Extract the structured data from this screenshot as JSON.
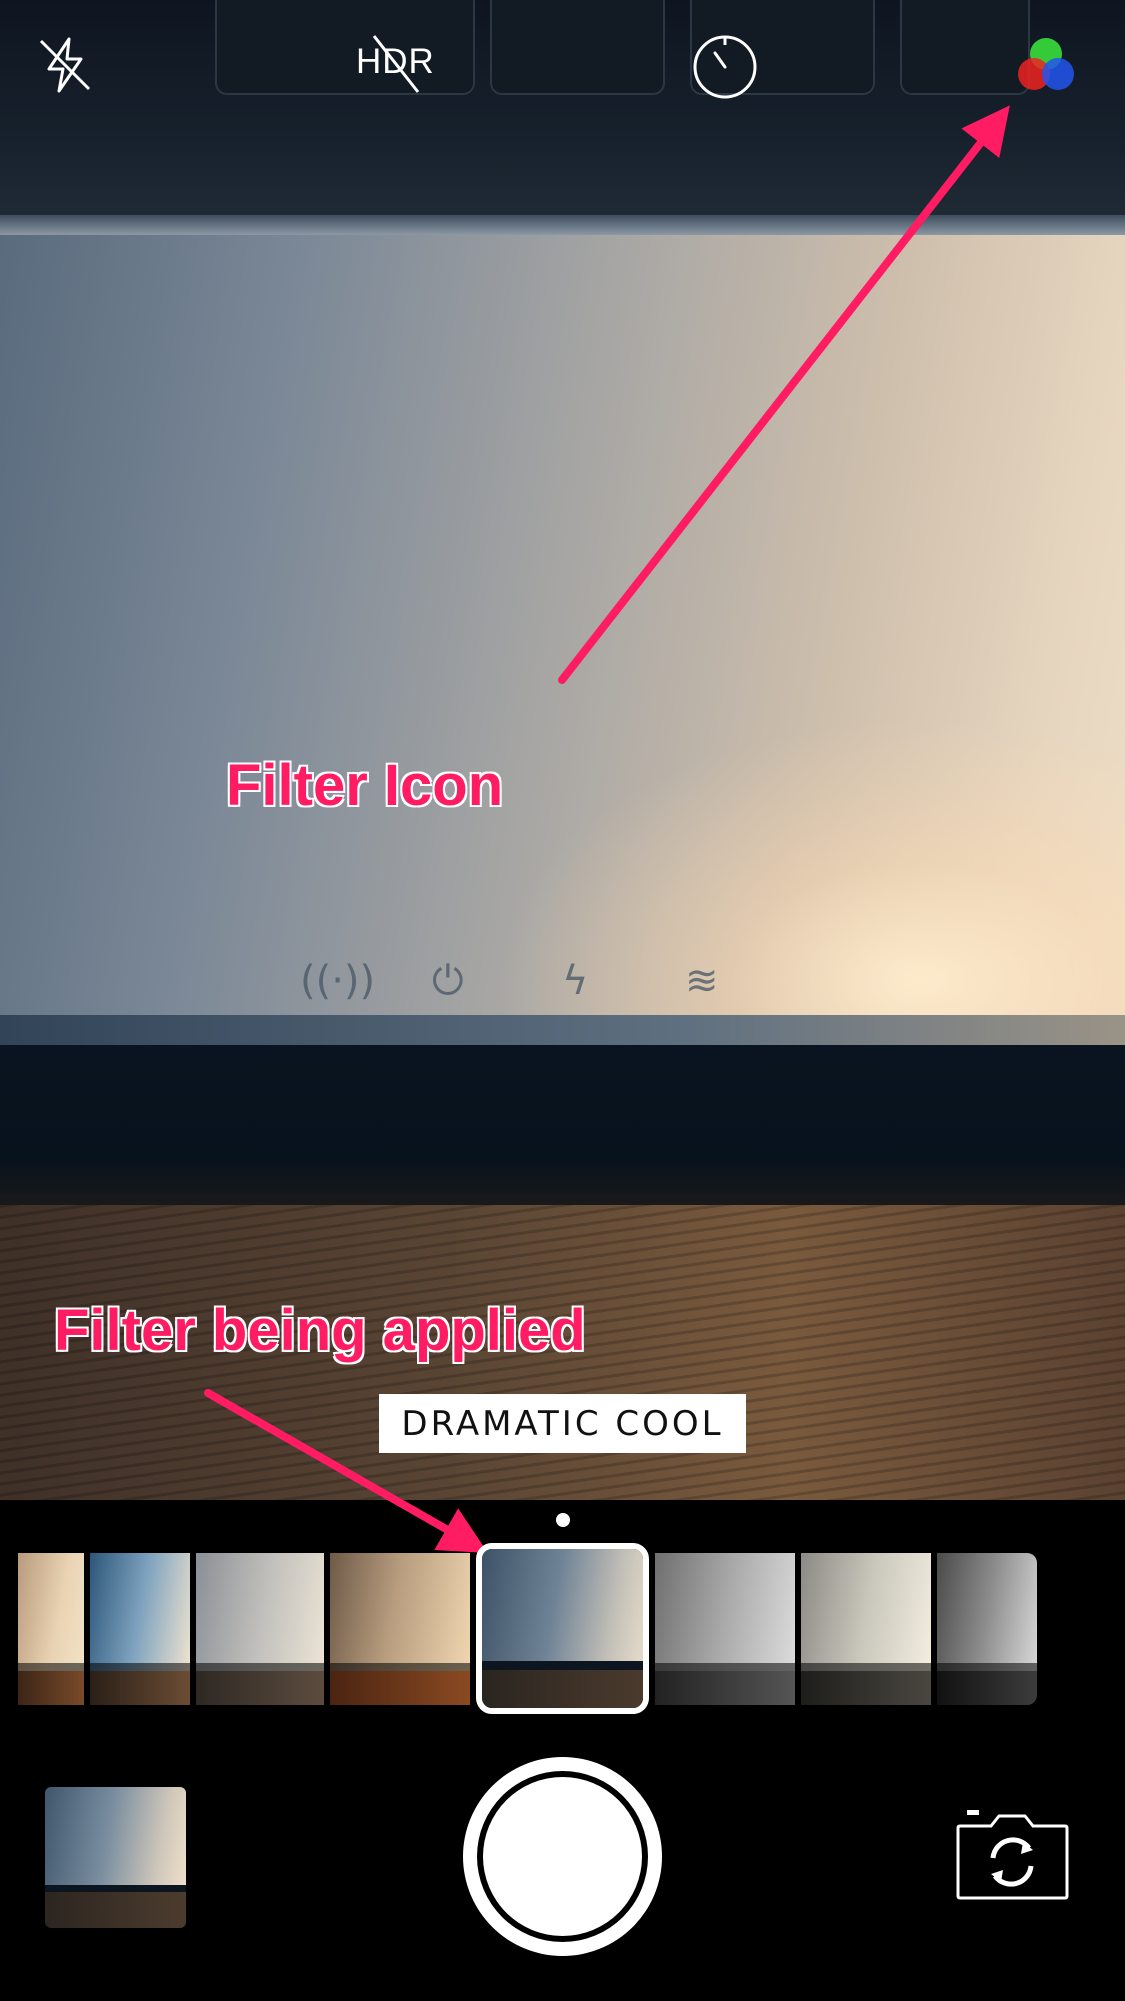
{
  "top_bar": {
    "flash_icon": "flash-off-icon",
    "hdr_label": "HDR",
    "timer_icon": "timer-icon",
    "filters_icon": "filters-icon"
  },
  "annotations": {
    "filter_icon_label": "Filter Icon",
    "filter_applied_label": "Filter being applied",
    "color": "#ff1c63"
  },
  "filter": {
    "current_name": "DRAMATIC COOL"
  },
  "filter_strip": {
    "item_count": 8,
    "selected_index": 4
  },
  "bottom_bar": {
    "last_photo_icon": "last-photo-thumbnail",
    "shutter_icon": "shutter-button",
    "switch_camera_icon": "switch-camera-icon"
  }
}
